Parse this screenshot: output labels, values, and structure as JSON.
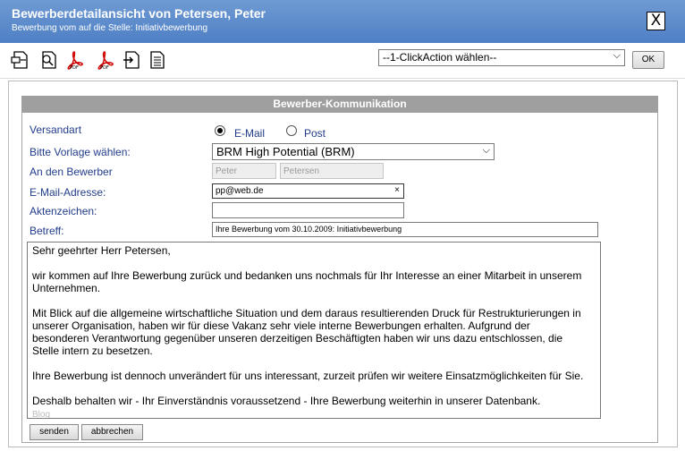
{
  "window": {
    "title": "Bewerberdetailansicht von Petersen, Peter",
    "subtitle": "Bewerbung vom auf die Stelle: Initiativbewerbung",
    "close_label": "X"
  },
  "toolbar": {
    "icons": [
      "document-icon",
      "document-search-icon",
      "pdf-icon",
      "pdf-icon",
      "forward-icon",
      "text-document-icon"
    ],
    "clickaction_value": "--1-ClickAction wählen--",
    "ok_label": "OK"
  },
  "panel": {
    "header": "Bewerber-Kommunikation"
  },
  "form": {
    "versandart_label": "Versandart",
    "radio_email": "E-Mail",
    "radio_post": "Post",
    "vorlage_label": "Bitte Vorlage wählen:",
    "vorlage_value": "BRM High Potential (BRM)",
    "bewerber_label": "An den Bewerber",
    "vorname_value": "Peter",
    "nachname_value": "Petersen",
    "email_label": "E-Mail-Adresse:",
    "email_value": "pp@web.de",
    "email_clear": "×",
    "aktenzeichen_label": "Aktenzeichen:",
    "aktenzeichen_value": "",
    "betreff_label": "Betreff:",
    "betreff_value": "Ihre Bewerbung vom 30.10.2009: Initiativbewerbung"
  },
  "message": {
    "p1": "Sehr geehrter Herr Petersen,",
    "p2": "wir kommen auf Ihre Bewerbung zurück und bedanken uns nochmals für Ihr Interesse an einer Mitarbeit in unserem Unternehmen.",
    "p3": "Mit Blick auf die allgemeine wirtschaftliche Situation und dem daraus resultierenden Druck für Restrukturierungen in unserer Organisation, haben wir für diese Vakanz sehr viele interne Bewerbungen erhalten. Aufgrund der besonderen Verantwortung gegenüber unseren derzeitigen Beschäftigten haben wir uns dazu entschlossen, die Stelle intern zu besetzen.",
    "p4": "Ihre Bewerbung ist dennoch unverändert für uns interessant, zurzeit prüfen wir weitere Einsatzmöglichkeiten für Sie.",
    "p5": "Deshalb behalten wir - Ihr Einverständnis voraussetzend - Ihre Bewerbung weiterhin in unserer Datenbank.",
    "p6": "Blog"
  },
  "buttons": {
    "send": "senden",
    "cancel": "abbrechen"
  }
}
